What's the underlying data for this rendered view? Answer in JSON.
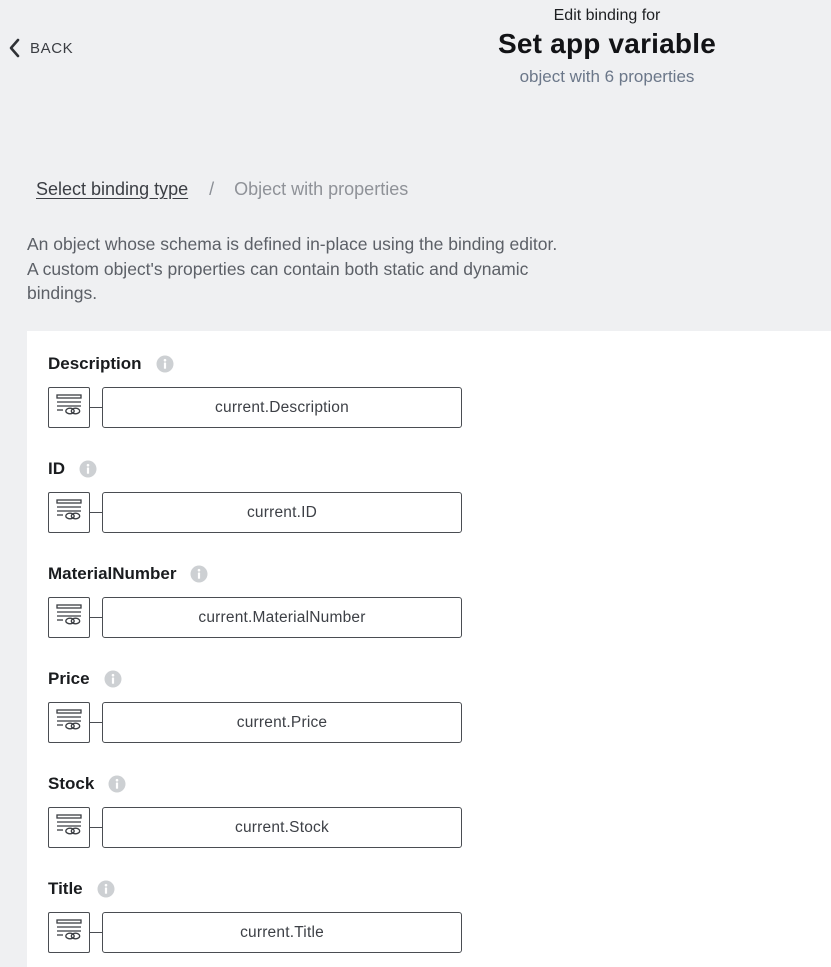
{
  "nav": {
    "back_label": "BACK"
  },
  "header": {
    "pre_title": "Edit binding for",
    "title": "Set app variable",
    "subtitle": "object with 6 properties"
  },
  "breadcrumb": {
    "link_label": "Select binding type",
    "separator": "/",
    "current_label": "Object with properties"
  },
  "description": {
    "line1": "An object whose schema is defined in-place using the binding editor.",
    "line2": "A custom object's properties can contain both static and dynamic",
    "line3": "bindings."
  },
  "properties": [
    {
      "label": "Description",
      "binding": "current.Description",
      "icon": "info-icon"
    },
    {
      "label": "ID",
      "binding": "current.ID",
      "icon": "info-icon"
    },
    {
      "label": "MaterialNumber",
      "binding": "current.MaterialNumber",
      "icon": "info-icon"
    },
    {
      "label": "Price",
      "binding": "current.Price",
      "icon": "info-icon"
    },
    {
      "label": "Stock",
      "binding": "current.Stock",
      "icon": "info-icon"
    },
    {
      "label": "Title",
      "binding": "current.Title",
      "icon": "info-icon"
    }
  ],
  "binding_type_icon": "formula-binding-icon",
  "colors": {
    "background": "#eff0f2",
    "panel": "#ffffff",
    "subtitle": "#6b7789",
    "border": "#4a4d52",
    "info_icon": "#c9cccf"
  }
}
